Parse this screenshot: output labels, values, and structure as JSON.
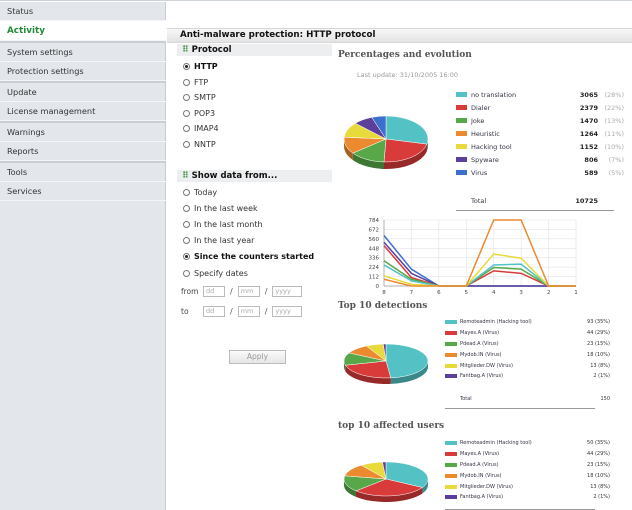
{
  "sidebar": {
    "groups": [
      [
        "Status",
        "Activity"
      ],
      [
        "System settings",
        "Protection settings"
      ],
      [
        "Update",
        "License management"
      ],
      [
        "Warnings",
        "Reports"
      ],
      [
        "Tools",
        "Services"
      ]
    ],
    "active": "Activity"
  },
  "page": {
    "title": "Anti-malware protection: HTTP protocol"
  },
  "protocol": {
    "heading": "Protocol",
    "options": [
      "HTTP",
      "FTP",
      "SMTP",
      "POP3",
      "IMAP4",
      "NNTP"
    ],
    "selected": "HTTP"
  },
  "show_data": {
    "heading": "Show data from...",
    "options": [
      "Today",
      "In the last week",
      "In the last month",
      "In the last year",
      "Since the counters started",
      "Specify dates"
    ],
    "selected": "Since the counters started",
    "from_label": "from",
    "to_label": "to",
    "placeholders": {
      "dd": "dd",
      "mm": "mm",
      "yyyy": "yyyy"
    },
    "apply_label": "Apply"
  },
  "percentages": {
    "title": "Percentages and evolution",
    "last_update": "Last update: 31/10/2005 16:00",
    "items": [
      {
        "name": "no translation",
        "value": "3065",
        "pct": "(28%)",
        "color": "#54c2c4"
      },
      {
        "name": "Dialer",
        "value": "2379",
        "pct": "(22%)",
        "color": "#d93b3b"
      },
      {
        "name": "Joke",
        "value": "1470",
        "pct": "(13%)",
        "color": "#58a84a"
      },
      {
        "name": "Heuristic",
        "value": "1264",
        "pct": "(11%)",
        "color": "#ec8a2f"
      },
      {
        "name": "Hacking tool",
        "value": "1152",
        "pct": "(10%)",
        "color": "#e8da3a"
      },
      {
        "name": "Spyware",
        "value": "806",
        "pct": "(7%)",
        "color": "#5b3f9a"
      },
      {
        "name": "Virus",
        "value": "589",
        "pct": "(5%)",
        "color": "#3d6fcc"
      }
    ],
    "total_label": "Total",
    "total_value": "10725"
  },
  "chart_data": {
    "type": "line",
    "x": [
      "8",
      "7",
      "6",
      "5",
      "4",
      "3",
      "2",
      "1"
    ],
    "yticks": [
      "784",
      "672",
      "560",
      "448",
      "336",
      "224",
      "112",
      "0"
    ],
    "ylim": [
      0,
      784
    ],
    "series": [
      {
        "color": "#3d6fcc",
        "values": [
          600,
          200,
          0,
          0,
          0,
          0,
          0,
          0
        ]
      },
      {
        "color": "#5b3f9a",
        "values": [
          520,
          150,
          0,
          0,
          0,
          0,
          0,
          0
        ]
      },
      {
        "color": "#d93b3b",
        "values": [
          480,
          100,
          0,
          0,
          180,
          150,
          0,
          0
        ]
      },
      {
        "color": "#58a84a",
        "values": [
          300,
          80,
          0,
          0,
          220,
          200,
          0,
          0
        ]
      },
      {
        "color": "#54c2c4",
        "values": [
          250,
          60,
          0,
          0,
          250,
          260,
          0,
          0
        ]
      },
      {
        "color": "#e8da3a",
        "values": [
          120,
          20,
          0,
          0,
          380,
          330,
          0,
          0
        ]
      },
      {
        "color": "#ec8a2f",
        "values": [
          80,
          0,
          0,
          0,
          784,
          784,
          0,
          0
        ]
      }
    ],
    "grid": true
  },
  "top_detections": {
    "title": "Top 10 detections",
    "items": [
      {
        "name": "Remoteadmin (Hacking tool)",
        "pct": "93 (35%)",
        "color": "#54c2c4"
      },
      {
        "name": "Mayes.A (Virus)",
        "pct": "44 (29%)",
        "color": "#d93b3b"
      },
      {
        "name": "Pdead.A (Virus)",
        "pct": "23 (15%)",
        "color": "#58a84a"
      },
      {
        "name": "Mydob.IN (Virus)",
        "pct": "18 (10%)",
        "color": "#ec8a2f"
      },
      {
        "name": "Mitglieder.DW (Virus)",
        "pct": "13 (8%)",
        "color": "#e8da3a"
      },
      {
        "name": "Fantbag.A (Virus)",
        "pct": "2 (1%)",
        "color": "#5b3f9a"
      }
    ],
    "total_label": "Total",
    "total_value": "150"
  },
  "top_users": {
    "title": "top 10 affected users",
    "items": [
      {
        "name": "Remoteadmin (Hacking tool)",
        "pct": "50 (35%)",
        "color": "#54c2c4"
      },
      {
        "name": "Mayes.A (Virus)",
        "pct": "44 (29%)",
        "color": "#d93b3b"
      },
      {
        "name": "Pdead.A (Virus)",
        "pct": "23 (15%)",
        "color": "#58a84a"
      },
      {
        "name": "Mydob.IN (Virus)",
        "pct": "18 (10%)",
        "color": "#ec8a2f"
      },
      {
        "name": "Mitglieder.DW (Virus)",
        "pct": "13 (8%)",
        "color": "#e8da3a"
      },
      {
        "name": "Fantbag.A (Virus)",
        "pct": "2 (1%)",
        "color": "#5b3f9a"
      }
    ]
  }
}
